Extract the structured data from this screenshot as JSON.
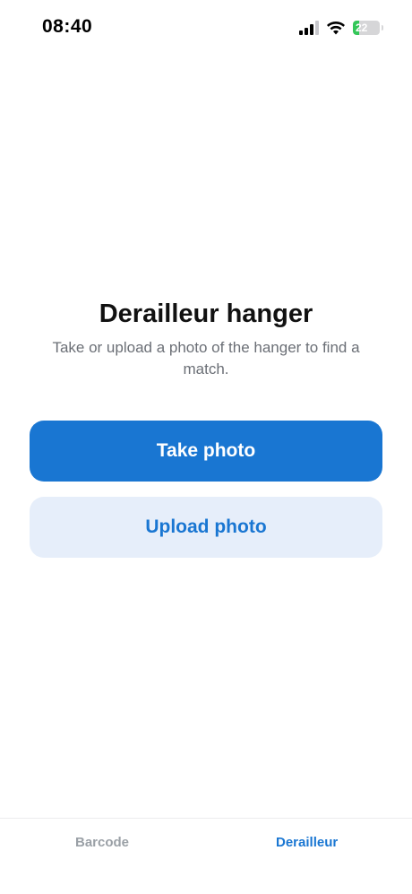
{
  "status_bar": {
    "time": "08:40",
    "battery_level": "22",
    "battery_percent": 22,
    "signal_icon": "cellular-signal-icon",
    "wifi_icon": "wifi-icon",
    "battery_icon": "battery-charging-icon"
  },
  "main": {
    "title": "Derailleur hanger",
    "subtitle": "Take or upload a photo of the hanger to find a match.",
    "take_photo_label": "Take photo",
    "upload_photo_label": "Upload photo"
  },
  "tab_bar": {
    "tabs": [
      {
        "label": "Barcode",
        "active": false
      },
      {
        "label": "Derailleur",
        "active": true
      }
    ]
  },
  "colors": {
    "accent": "#1976d2",
    "secondary_button_bg": "#e6eefa",
    "subtitle_text": "#6b6f76",
    "inactive_tab": "#9aa0a6",
    "battery_green": "#34c759"
  }
}
